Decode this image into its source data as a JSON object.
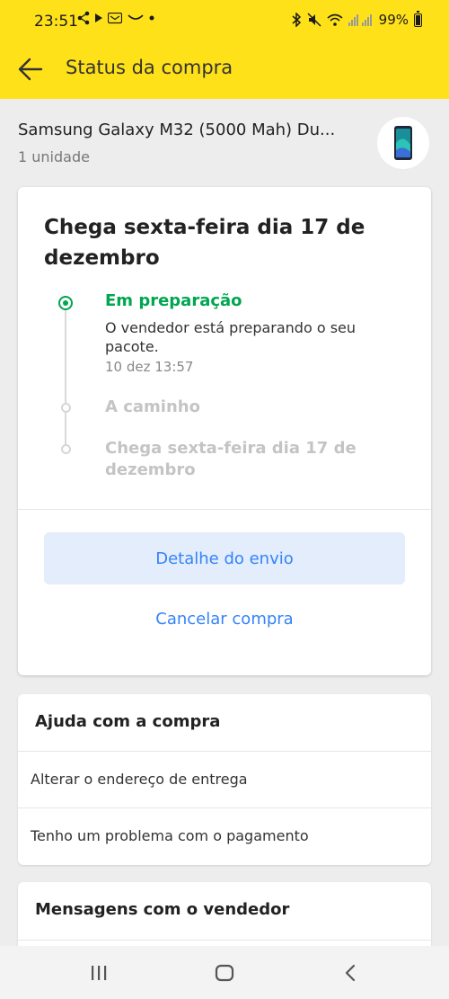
{
  "status_bar": {
    "time": "23:51",
    "battery": "99%"
  },
  "app_bar": {
    "title": "Status da compra"
  },
  "product": {
    "name": "Samsung Galaxy M32 (5000 Mah) Du...",
    "quantity": "1 unidade"
  },
  "shipment": {
    "eta_title": "Chega sexta-feira dia 17 de dezembro",
    "steps": [
      {
        "title": "Em preparação",
        "description": "O vendedor está preparando o seu pacote.",
        "date": "10 dez 13:57",
        "state": "active"
      },
      {
        "title": "A caminho",
        "state": "pending"
      },
      {
        "title": "Chega sexta-feira dia 17 de dezembro",
        "state": "pending"
      }
    ],
    "details_button": "Detalhe do envio",
    "cancel_button": "Cancelar compra"
  },
  "help": {
    "title": "Ajuda com a compra",
    "items": [
      {
        "label": "Alterar o endereço de entrega"
      },
      {
        "label": "Tenho um problema com o pagamento"
      }
    ]
  },
  "messages": {
    "title": "Mensagens com o vendedor"
  },
  "colors": {
    "brand_yellow": "#ffe11a",
    "success_green": "#00a650",
    "link_blue": "#3483fa",
    "button_bg": "#e3edfb"
  },
  "icons": {
    "back": "arrow-left-icon",
    "nav_recent": "recent-apps-icon",
    "nav_home": "home-icon",
    "nav_back": "nav-back-icon"
  }
}
